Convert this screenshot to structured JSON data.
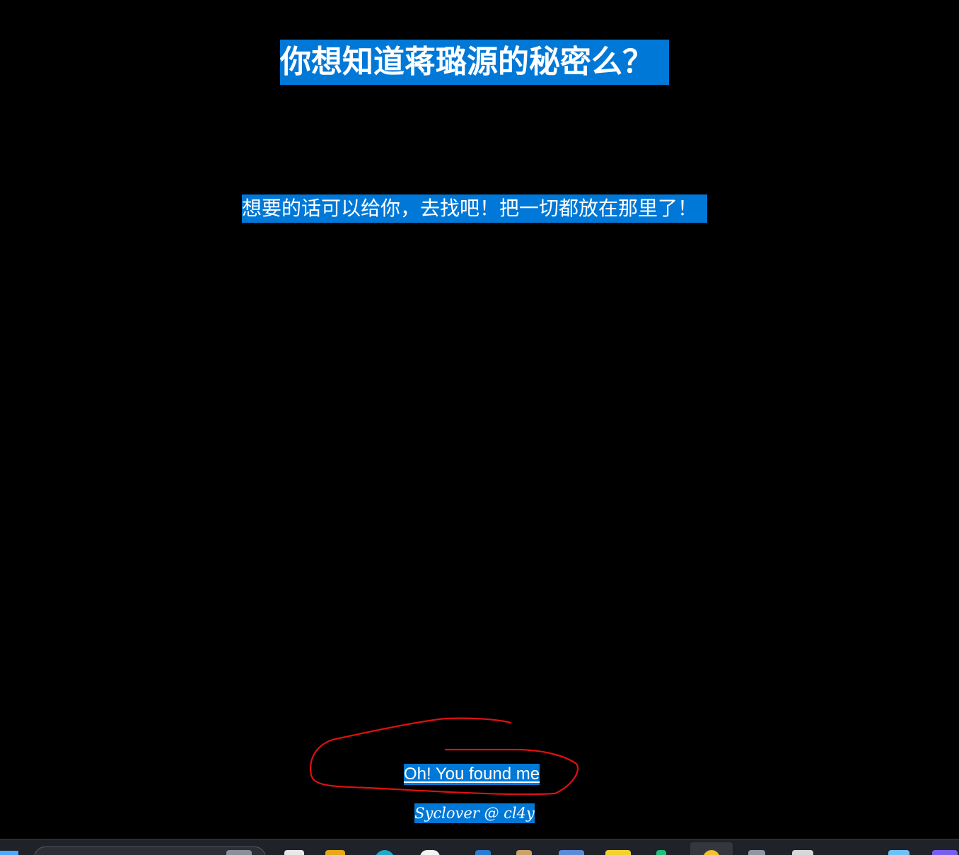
{
  "page": {
    "title": "你想知道蒋璐源的秘密么？",
    "subtitle": "想要的话可以给你，去找吧！把一切都放在那里了！",
    "hidden_link": "Oh! You found me",
    "credit": "Syclover @ cl4y"
  },
  "colors": {
    "background": "#000000",
    "selection": "#0078d7",
    "text": "#ffffff",
    "annotation_stroke": "#e01010"
  },
  "taskbar": {
    "icons": [
      "windows-start-icon",
      "search-box",
      "file-icon",
      "folder-icon",
      "edge-icon",
      "app-icon",
      "vscode-icon",
      "app-icon",
      "app-icon",
      "notes-icon",
      "app-icon",
      "warning-icon",
      "shield-icon",
      "app-icon",
      "calendar-icon",
      "app-icon"
    ]
  }
}
